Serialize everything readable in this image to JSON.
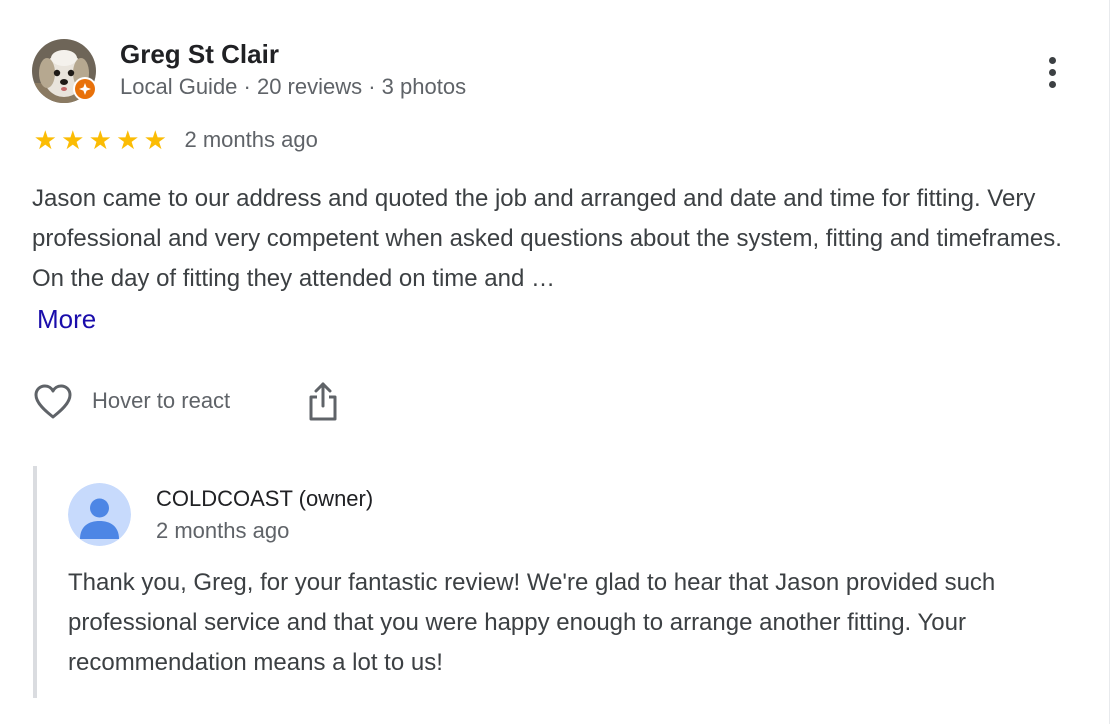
{
  "review": {
    "reviewer": {
      "name": "Greg St Clair",
      "meta": "Local Guide · 20 reviews · 3 photos",
      "badge_icon": "local-guide-badge-icon",
      "badge_color": "#e8710a"
    },
    "rating": {
      "stars": 5,
      "max": 5,
      "star_glyph": "★",
      "color": "#fbbc04"
    },
    "time": "2 months ago",
    "text": "Jason came to our address and quoted the job and arranged and date and time for fitting. Very professional and very competent when asked questions about the system, fitting and timeframes. On the day of fitting they attended on time and …",
    "more_label": "More",
    "more_color": "#1a0dab",
    "actions": {
      "react_icon": "heart-icon",
      "react_label": "Hover to react",
      "share_icon": "share-icon"
    },
    "menu_icon": "more-vert-icon"
  },
  "owner_response": {
    "name": "COLDCOAST (owner)",
    "time": "2 months ago",
    "avatar_icon": "default-user-avatar-icon",
    "avatar_color": "#4d86e5",
    "text": "Thank you, Greg, for your fantastic review! We're glad to hear that Jason provided such professional service and that you were happy enough to arrange another fitting. Your recommendation means a lot to us!"
  }
}
